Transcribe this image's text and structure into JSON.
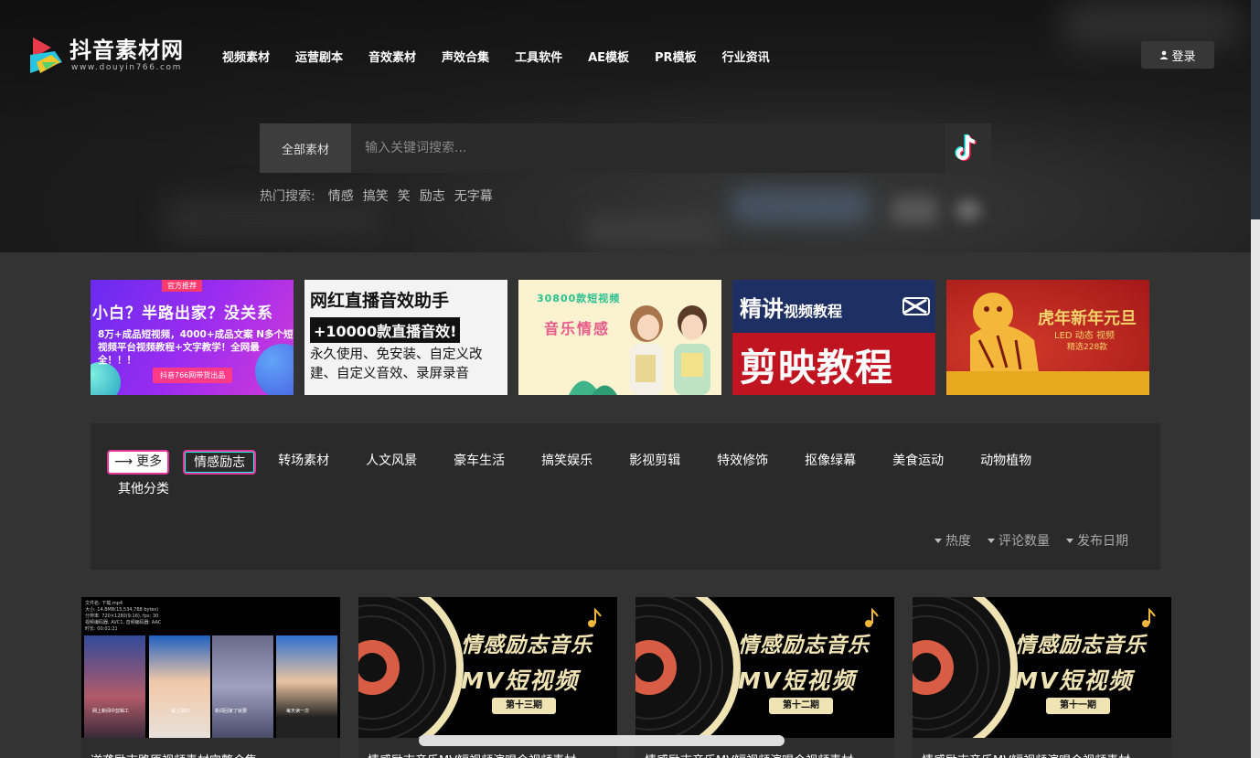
{
  "brand": {
    "name": "抖音素材网",
    "url": "www.douyin766.com"
  },
  "nav": [
    "视频素材",
    "运营剧本",
    "音效素材",
    "声效合集",
    "工具软件",
    "AE模板",
    "PR模板",
    "行业资讯"
  ],
  "login_label": "登录",
  "search": {
    "category": "全部素材",
    "placeholder": "输入关键词搜索...",
    "hot_label": "热门搜索:",
    "hot_keywords": [
      "情感",
      "搞笑",
      "笑",
      "励志",
      "无字幕"
    ]
  },
  "banners": {
    "b1": {
      "tag": "官方推荐",
      "line1": "小白？半路出家？没关系",
      "line2": "8万+成品短视频，4000+成品文案 N多个短视频平台视频教程+文字教学！全网最全！！！",
      "button": "抖音766网带货出品"
    },
    "b2": {
      "line1": "网红直播音效助手",
      "line2": "+10000款直播音效!",
      "line3": "永久使用、免安装、自定义改建、自定义音效、录屏录音"
    },
    "b3": {
      "line1": "30800款短视频",
      "line2": "音乐情感"
    },
    "b4": {
      "line1a": "精讲",
      "line1b": "视频教程",
      "line2": "剪映教程"
    },
    "b5": {
      "line1": "虎年新年元旦",
      "line2": "LED 动态 视频",
      "line3": "精选228款"
    }
  },
  "categories": {
    "more": "更多",
    "items": [
      "情感励志",
      "转场素材",
      "人文风景",
      "豪车生活",
      "搞笑娱乐",
      "影视剪辑",
      "特效修饰",
      "抠像绿幕",
      "美食运动",
      "动物植物",
      "其他分类"
    ],
    "sorts": [
      "热度",
      "评论数量",
      "发布日期"
    ]
  },
  "cards": [
    {
      "title": "逆袭励志路原视频素材完整合集",
      "captions": [
        "网上新闻中剪辑工",
        "褐上扶的",
        "新闻回家了就要",
        "每天读一次"
      ]
    },
    {
      "title": "情感励志音乐MV短视频演唱会视频素材",
      "line1": "情感励志音乐",
      "line2": "MV短视频",
      "issue": "第十三期"
    },
    {
      "title": "情感励志音乐MV短视频演唱会视频素材",
      "line1": "情感励志音乐",
      "line2": "MV短视频",
      "issue": "第十二期"
    },
    {
      "title": "情感励志音乐MV短视频演唱会视频素材",
      "line1": "情感励志音乐",
      "line2": "MV短视频",
      "issue": "第十一期"
    }
  ],
  "colors": {
    "accent_pink": "#e0369a",
    "accent_cyan": "#25f4ee",
    "page_bg": "#333333",
    "panel_bg": "#2a2a2a"
  }
}
